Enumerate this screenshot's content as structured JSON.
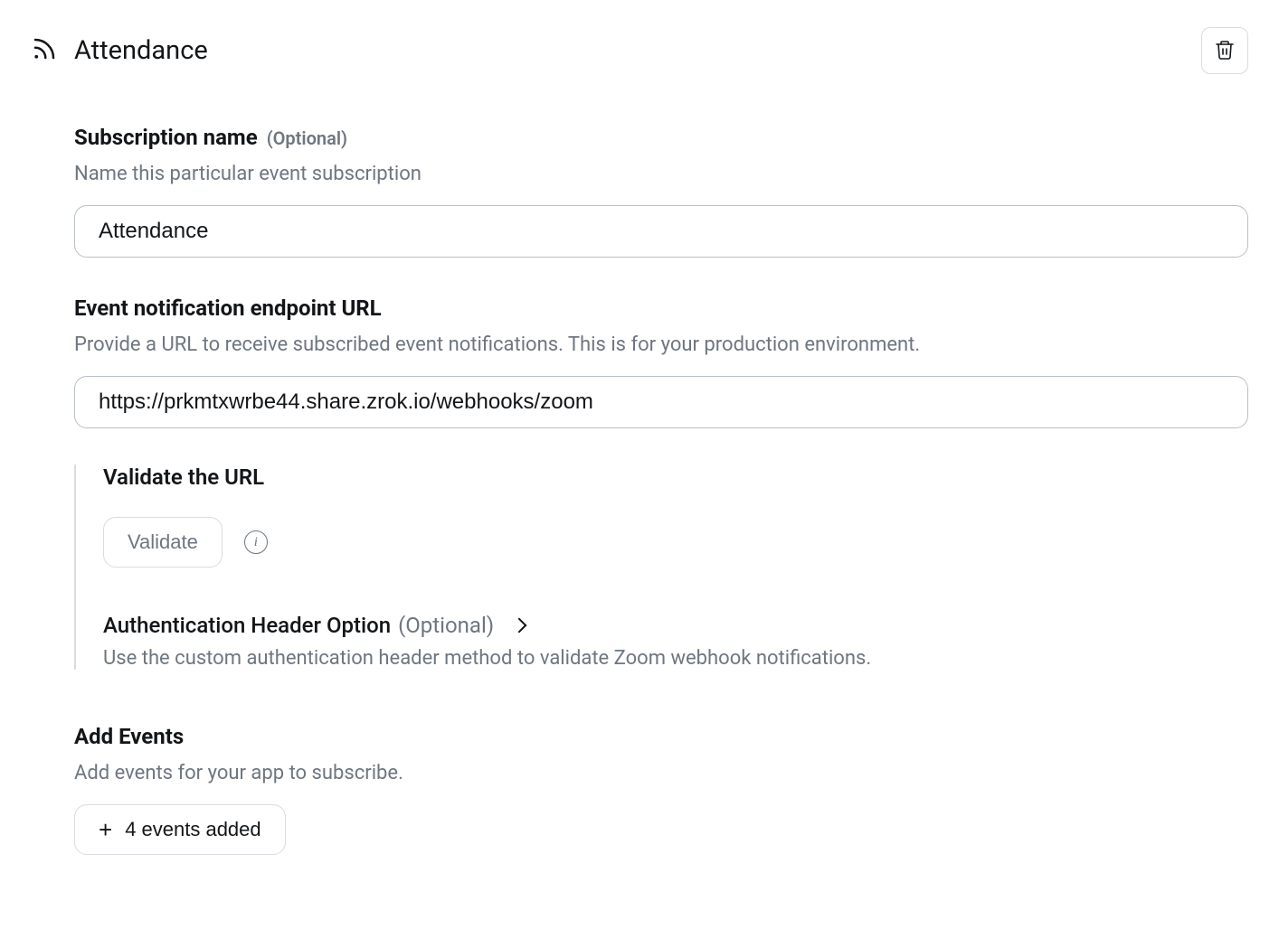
{
  "header": {
    "title": "Attendance"
  },
  "subscription": {
    "label": "Subscription name",
    "optional": "(Optional)",
    "description": "Name this particular event subscription",
    "value": "Attendance"
  },
  "endpoint": {
    "label": "Event notification endpoint URL",
    "description": "Provide a URL to receive subscribed event notifications. This is for your production environment.",
    "value": "https://prkmtxwrbe44.share.zrok.io/webhooks/zoom"
  },
  "validate": {
    "heading": "Validate the URL",
    "button": "Validate"
  },
  "auth": {
    "title": "Authentication Header Option",
    "optional": "(Optional)",
    "description": "Use the custom authentication header method to validate Zoom webhook notifications."
  },
  "events": {
    "label": "Add Events",
    "description": "Add events for your app to subscribe.",
    "button": "4 events added"
  }
}
